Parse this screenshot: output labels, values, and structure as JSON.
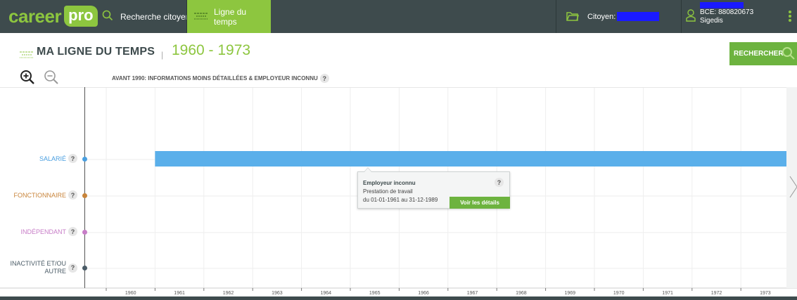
{
  "topbar": {
    "logo_word1": "career",
    "logo_word2": "pro",
    "nav_search_label": "Recherche citoyen",
    "nav_timeline_label": "Ligne du temps",
    "citoyen_label": "Citoyen:",
    "bce_label": "BCE: 880820673",
    "org_label": "Sigedis"
  },
  "header": {
    "title": "MA LIGNE DU TEMPS",
    "separator": "|",
    "range": "1960 - 1973",
    "search_button": "RECHERCHER",
    "notice": "AVANT 1990: INFORMATIONS MOINS DÉTAILLÉES & EMPLOYEUR INCONNU",
    "help": "?"
  },
  "timeline": {
    "years": [
      "1960",
      "1961",
      "1962",
      "1963",
      "1964",
      "1965",
      "1966",
      "1967",
      "1968",
      "1969",
      "1970",
      "1971",
      "1972",
      "1973"
    ],
    "rows": [
      {
        "label": "SALARIÉ",
        "color": "#4a9fe0"
      },
      {
        "label": "FONCTIONNAIRE",
        "color": "#c8843a"
      },
      {
        "label": "INDÉPENDANT",
        "color": "#c77dc7"
      },
      {
        "label_line1": "INACTIVITÉ ET/OU",
        "label_line2": "AUTRE",
        "color": "#4a5b66"
      }
    ],
    "bar_color": "#5aafea"
  },
  "tooltip": {
    "title": "Employeur inconnu",
    "type": "Prestation de travail",
    "period": "du 01-01-1961 au 31-12-1989",
    "button": "Voir les détails",
    "help": "?"
  },
  "colors": {
    "topbar": "#3e4b4d",
    "accent_green": "#8dc63f",
    "button_green": "#6db33f"
  }
}
